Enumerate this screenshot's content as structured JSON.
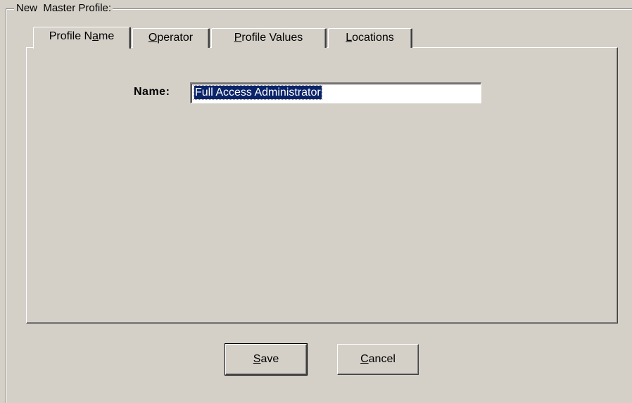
{
  "group": {
    "title": "New  Master Profile:"
  },
  "tabs": [
    {
      "pre": "Profile N",
      "ul": "a",
      "post": "me",
      "selected": true
    },
    {
      "pre": "",
      "ul": "O",
      "post": "perator",
      "selected": false
    },
    {
      "pre": "",
      "ul": "P",
      "post": "rofile Values",
      "selected": false
    },
    {
      "pre": "",
      "ul": "L",
      "post": "ocations",
      "selected": false
    }
  ],
  "form": {
    "name_label": "Name:",
    "name_value": "Full Access Administrator"
  },
  "buttons": {
    "save": {
      "ul": "S",
      "post": "ave"
    },
    "cancel": {
      "ul": "C",
      "post": "ancel"
    }
  }
}
